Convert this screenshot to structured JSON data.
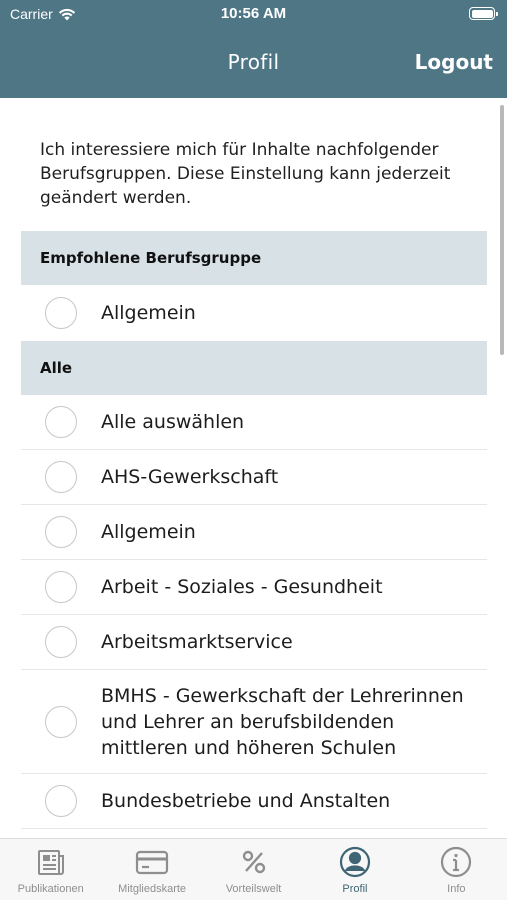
{
  "status_bar": {
    "carrier": "Carrier",
    "time": "10:56 AM"
  },
  "nav": {
    "title": "Profil",
    "logout_label": "Logout"
  },
  "intro_text": "Ich interessiere mich für Inhalte nachfolgender Berufsgruppen. Diese Einstellung kann jederzeit geändert werden.",
  "sections": [
    {
      "header": "Empfohlene Berufsgruppe",
      "items": [
        "Allgemein"
      ]
    },
    {
      "header": "Alle",
      "items": [
        "Alle auswählen",
        "AHS-Gewerkschaft",
        "Allgemein",
        "Arbeit - Soziales - Gesundheit",
        "Arbeitsmarktservice",
        "BMHS - Gewerkschaft der Lehrerinnen und Lehrer an berufsbildenden mittleren und höheren Schulen",
        "Bundesbetriebe und Anstalten"
      ]
    }
  ],
  "tabs": [
    {
      "label": "Publikationen",
      "icon": "newspaper-icon",
      "active": false
    },
    {
      "label": "Mitgliedskarte",
      "icon": "card-icon",
      "active": false
    },
    {
      "label": "Vorteilswelt",
      "icon": "percent-icon",
      "active": false
    },
    {
      "label": "Profil",
      "icon": "profile-icon",
      "active": true
    },
    {
      "label": "Info",
      "icon": "info-icon",
      "active": false
    }
  ],
  "colors": {
    "nav_bg": "#4f7685",
    "section_bg": "#d7e1e6",
    "active_tab": "#3f6574",
    "inactive_tab": "#8e8e8e"
  }
}
